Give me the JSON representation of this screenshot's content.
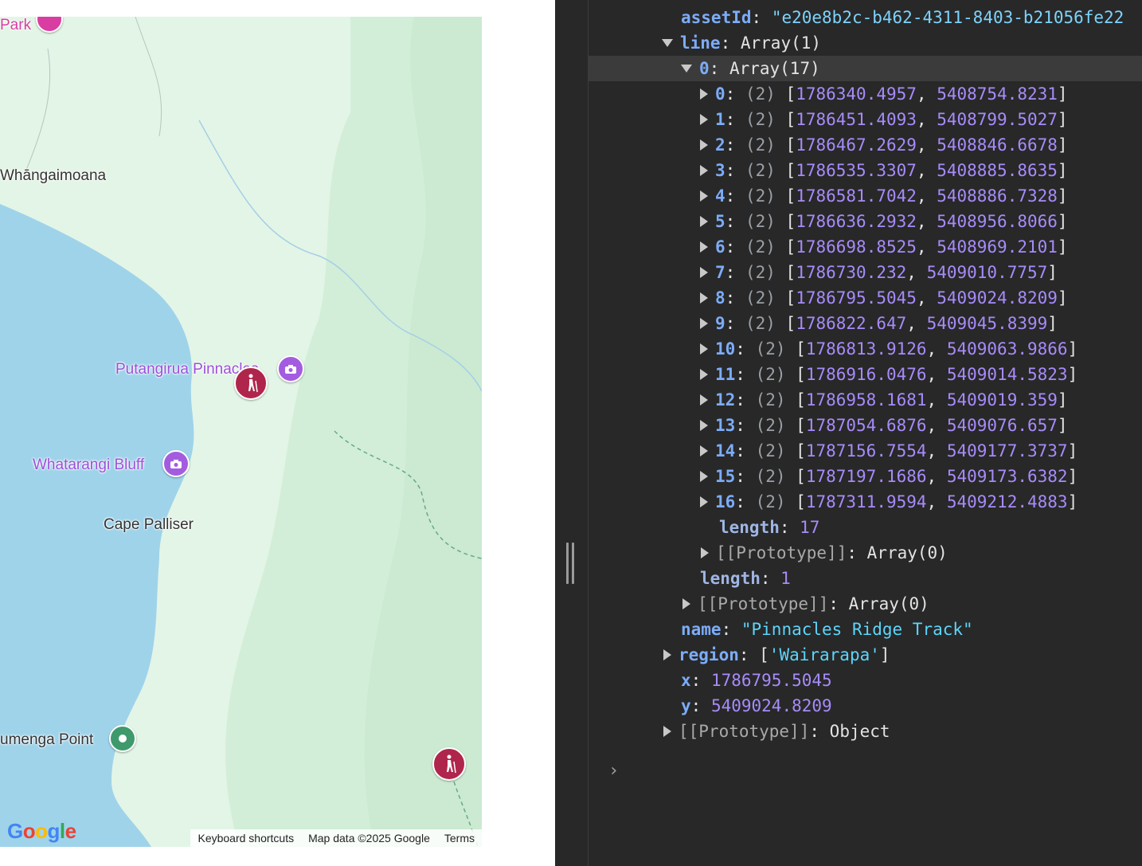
{
  "map": {
    "labels": {
      "park": "Park",
      "whangaimoana": "Whāngaimoana",
      "putangirua": "Putangirua Pinnacles",
      "whatarangi": "Whatarangi Bluff",
      "cape_palliser": "Cape Palliser",
      "umenga": "umenga Point"
    },
    "logo": "Google",
    "footer": {
      "shortcuts": "Keyboard shortcuts",
      "map_data": "Map data ©2025 Google",
      "terms": "Terms"
    },
    "colors": {
      "land": "#e3f5e6",
      "water": "#9fd3ea",
      "hike_pin": "#b0254b",
      "camera_pin": "#a35ce0",
      "green_pin": "#3e9a6c"
    }
  },
  "console": {
    "asset_id_key": "assetId",
    "asset_id_value": "\"e20e8b2c-b462-4311-8403-b21056fe22",
    "line_key": "line",
    "line_value": "Array(1)",
    "inner_key": "0",
    "inner_value": "Array(17)",
    "points": [
      {
        "i": "0",
        "a": "1786340.4957",
        "b": "5408754.8231"
      },
      {
        "i": "1",
        "a": "1786451.4093",
        "b": "5408799.5027"
      },
      {
        "i": "2",
        "a": "1786467.2629",
        "b": "5408846.6678"
      },
      {
        "i": "3",
        "a": "1786535.3307",
        "b": "5408885.8635"
      },
      {
        "i": "4",
        "a": "1786581.7042",
        "b": "5408886.7328"
      },
      {
        "i": "5",
        "a": "1786636.2932",
        "b": "5408956.8066"
      },
      {
        "i": "6",
        "a": "1786698.8525",
        "b": "5408969.2101"
      },
      {
        "i": "7",
        "a": "1786730.232",
        "b": "5409010.7757"
      },
      {
        "i": "8",
        "a": "1786795.5045",
        "b": "5409024.8209"
      },
      {
        "i": "9",
        "a": "1786822.647",
        "b": "5409045.8399"
      },
      {
        "i": "10",
        "a": "1786813.9126",
        "b": "5409063.9866"
      },
      {
        "i": "11",
        "a": "1786916.0476",
        "b": "5409014.5823"
      },
      {
        "i": "12",
        "a": "1786958.1681",
        "b": "5409019.359"
      },
      {
        "i": "13",
        "a": "1787054.6876",
        "b": "5409076.657"
      },
      {
        "i": "14",
        "a": "1787156.7554",
        "b": "5409177.3737"
      },
      {
        "i": "15",
        "a": "1787197.1686",
        "b": "5409173.6382"
      },
      {
        "i": "16",
        "a": "1787311.9594",
        "b": "5409212.4883"
      }
    ],
    "pair_label": "(2)",
    "length_key": "length",
    "inner_length": "17",
    "outer_length": "1",
    "proto_key": "[[Prototype]]",
    "proto_array": "Array(0)",
    "proto_object": "Object",
    "name_key": "name",
    "name_value": "\"Pinnacles Ridge Track\"",
    "region_key": "region",
    "region_value": "'Wairarapa'",
    "x_key": "x",
    "x_value": "1786795.5045",
    "y_key": "y",
    "y_value": "5409024.8209",
    "prompt": "›"
  }
}
